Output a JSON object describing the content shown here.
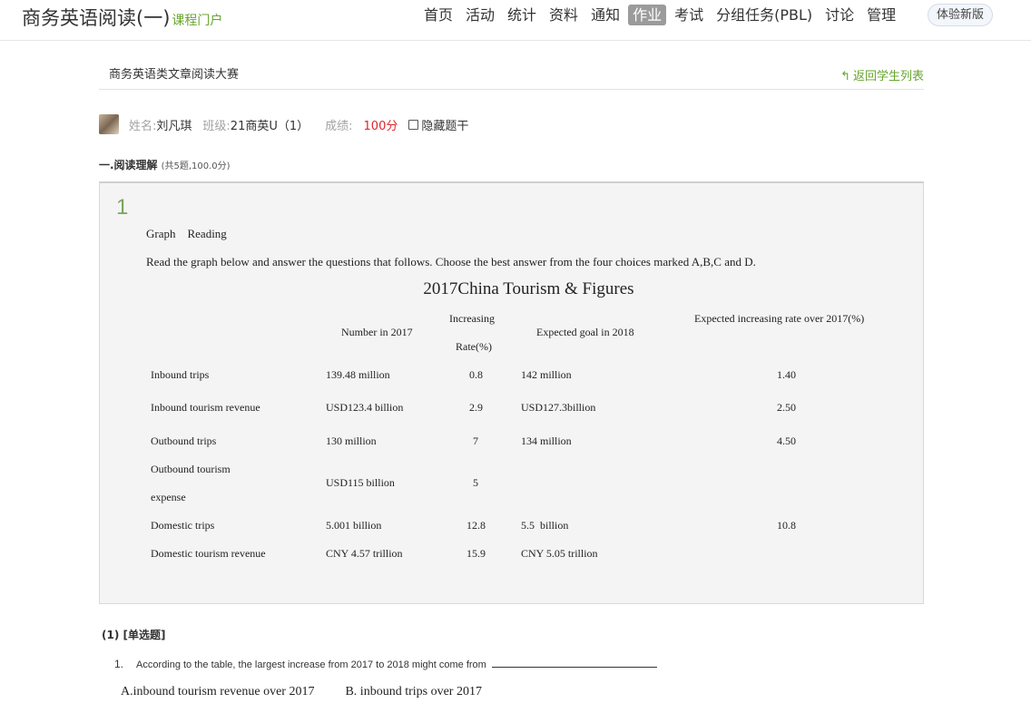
{
  "header": {
    "course_title": "商务英语阅读(一)",
    "course_portal": "课程门户",
    "nav": [
      "首页",
      "活动",
      "统计",
      "资料",
      "通知",
      "作业",
      "考试",
      "分组任务(PBL)",
      "讨论",
      "管理"
    ],
    "active_nav": "作业",
    "new_version_label": "体验新版"
  },
  "work": {
    "title": "商务英语类文章阅读大赛",
    "back_label": "返回学生列表"
  },
  "student": {
    "name_label": "姓名:",
    "name": "刘凡琪",
    "class_label": "班级:",
    "class": "21商英U（1）",
    "score_label": "成绩:",
    "score": "100分",
    "hide_stem_label": "隐藏题干"
  },
  "section": {
    "title": "一.阅读理解",
    "subtitle": "(共5题,100.0分)"
  },
  "question": {
    "number": "1",
    "graph_label": "Graph    Reading",
    "instruction": "Read the graph below and answer the questions that follows. Choose the best answer from the four choices marked A,B,C and D.",
    "table_title": "2017China Tourism & Figures",
    "headers": {
      "number_2017": "Number in 2017",
      "increasing_1": "Increasing",
      "increasing_2": "Rate(%)",
      "goal_2018": "Expected goal in 2018",
      "expected_rate": "Expected increasing rate over 2017(%)"
    },
    "rows": [
      {
        "item": "Inbound trips",
        "item2": "",
        "number": "139.48 million",
        "rate": "0.8",
        "goal": "142 million",
        "exp_rate": "1.40"
      },
      {
        "item": "Inbound tourism revenue",
        "item2": "",
        "number": "USD123.4 billion",
        "rate": "2.9",
        "goal": "USD127.3billion",
        "exp_rate": "2.50"
      },
      {
        "item": "Outbound trips",
        "item2": "",
        "number": "130 million",
        "rate": "7",
        "goal": "134 million",
        "exp_rate": "4.50"
      },
      {
        "item": "Outbound tourism",
        "item2": "expense",
        "number": "USD115 billion",
        "rate": "5",
        "goal": "",
        "exp_rate": ""
      },
      {
        "item": "Domestic trips",
        "item2": "",
        "number": "5.001 billion",
        "rate": "12.8",
        "goal": "5.5  billion",
        "exp_rate": "10.8"
      },
      {
        "item": "Domestic tourism revenue",
        "item2": "",
        "number": "CNY 4.57 trillion",
        "rate": "15.9",
        "goal": "CNY 5.05 trillion",
        "exp_rate": ""
      }
    ]
  },
  "sub_question": {
    "type": "(1) [单选题]",
    "num": "1.",
    "text": "According to the table, the largest increase from 2017 to 2018 might come from",
    "option_a": "A.inbound tourism revenue over 2017",
    "option_b": "B. inbound trips over 2017"
  }
}
